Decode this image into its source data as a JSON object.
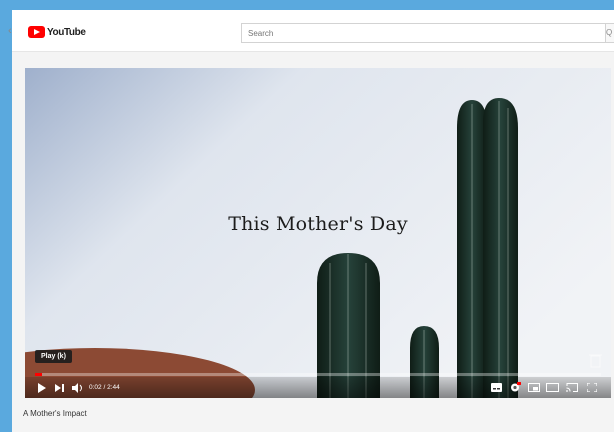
{
  "masthead": {
    "logo_text": "YouTube",
    "search_placeholder": "Search",
    "search_button_glyph": "Q"
  },
  "player": {
    "overlay_title": "This Mother's Day",
    "tooltip": "Play (k)",
    "time": "0:02 / 2:44",
    "progress_fraction": 0.012,
    "icons": [
      "play-icon",
      "next-icon",
      "volume-icon",
      "subtitles-icon",
      "settings-icon",
      "miniplayer-icon",
      "theater-icon",
      "cast-icon",
      "fullscreen-icon"
    ]
  },
  "video": {
    "title": "A Mother's Impact"
  },
  "colors": {
    "accent": "#ff0000",
    "page_bg": "#5aa9de",
    "sky": "#dfe6ef",
    "cactus": "#1b2f25"
  }
}
